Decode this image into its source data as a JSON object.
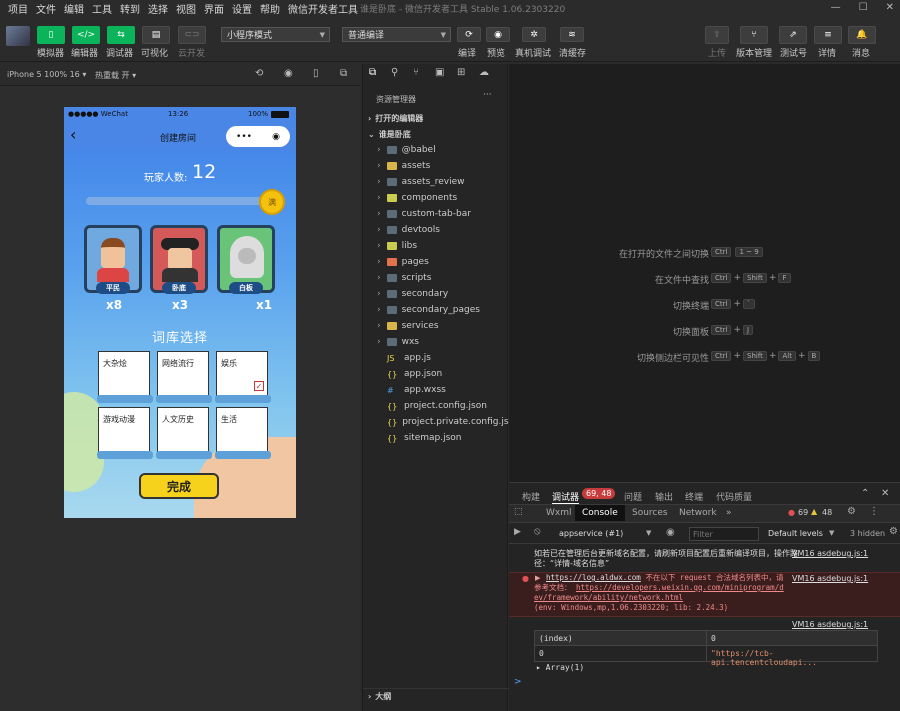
{
  "menu": {
    "items": [
      "项目",
      "文件",
      "编辑",
      "工具",
      "转到",
      "选择",
      "视图",
      "界面",
      "设置",
      "帮助",
      "微信开发者工具"
    ],
    "window_title": "谁是卧底 - 微信开发者工具 Stable 1.06.2303220"
  },
  "toolbar": {
    "simulator": "模拟器",
    "editor": "编辑器",
    "debugger": "调试器",
    "visual": "可视化",
    "cloud": "云开发",
    "mode": "小程序模式",
    "compile_mode": "普通编译",
    "compile": "编译",
    "preview": "预览",
    "real_debug": "真机调试",
    "clear_cache": "清缓存",
    "upload": "上传",
    "version": "版本管理",
    "test": "测试号",
    "details": "详情",
    "messages": "消息"
  },
  "simbar": {
    "device": "iPhone 5 100% 16 ▾",
    "hotreload": "热重载 开 ▾"
  },
  "phone": {
    "carrier": "●●●●● WeChat",
    "time": "13:26",
    "battery": "100%",
    "nav_title": "创建房间",
    "player_label": "玩家人数:",
    "player_count": "12",
    "coin": "满",
    "roles": [
      {
        "tag": "平民",
        "count": "x8"
      },
      {
        "tag": "卧底",
        "count": "x3"
      },
      {
        "tag": "白板",
        "count": "x1"
      }
    ],
    "lexicon_title": "词库选择",
    "words": [
      "大杂烩",
      "网络流行",
      "娱乐",
      "游戏动漫",
      "人文历史",
      "生活"
    ],
    "done": "完成"
  },
  "explorer": {
    "title": "资源管理器",
    "open_editors": "打开的编辑器",
    "project": "谁是卧底",
    "items": [
      "@babel",
      "assets",
      "assets_review",
      "components",
      "custom-tab-bar",
      "devtools",
      "libs",
      "pages",
      "scripts",
      "secondary",
      "secondary_pages",
      "services",
      "wxs",
      "app.js",
      "app.json",
      "app.wxss",
      "project.config.json",
      "project.private.config.js...",
      "sitemap.json"
    ],
    "outline": "大纲"
  },
  "editor_hints": [
    {
      "label": "在打开的文件之间切换",
      "keys": [
        "Ctrl",
        "1 ~ 9"
      ]
    },
    {
      "label": "在文件中查找",
      "keys": [
        "Ctrl",
        "+",
        "Shift",
        "+",
        "F"
      ]
    },
    {
      "label": "切换终端",
      "keys": [
        "Ctrl",
        "+",
        "`"
      ]
    },
    {
      "label": "切换面板",
      "keys": [
        "Ctrl",
        "+",
        "J"
      ]
    },
    {
      "label": "切换侧边栏可见性",
      "keys": [
        "Ctrl",
        "+",
        "Shift",
        "+",
        "Alt",
        "+",
        "B"
      ]
    }
  ],
  "devtools": {
    "tabs": [
      "构建",
      "调试器",
      "问题",
      "输出",
      "终端",
      "代码质量"
    ],
    "badge": "69, 48",
    "subtabs": [
      "Wxml",
      "Console",
      "Sources",
      "Network",
      "»"
    ],
    "errors": "69",
    "warnings": "48",
    "context": "appservice (#1)",
    "filter_placeholder": "Filter",
    "levels": "Default levels",
    "hidden": "3 hidden",
    "msg1": "如若已在管理后台更新域名配置，请刷新项目配置后重新编译项目，操作路径：“详情-域名信息”",
    "msg1_src": "VM16 asdebug.js:1",
    "err_url": "https://log.aldwx.com",
    "err_text": "不在以下 request 合法域名列表中，请参考文档：",
    "err_doc": "https://developers.weixin.qq.com/miniprogram/dev/framework/ability/network.html",
    "err_src": "VM16 asdebug.js:1",
    "err_env": "(env: Windows,mp,1.06.2303220; lib: 2.24.3)",
    "log_src": "VM16 asdebug.js:1",
    "table_head": [
      "(index)",
      "0"
    ],
    "table_row": [
      "0",
      "\"https://tcb-api.tencentcloudapi..."
    ],
    "array": "▸ Array(1)",
    "prompt": ">"
  },
  "colors": {
    "green": "#0bb35a",
    "error": "#e05252",
    "link": "#9cc4ff"
  }
}
